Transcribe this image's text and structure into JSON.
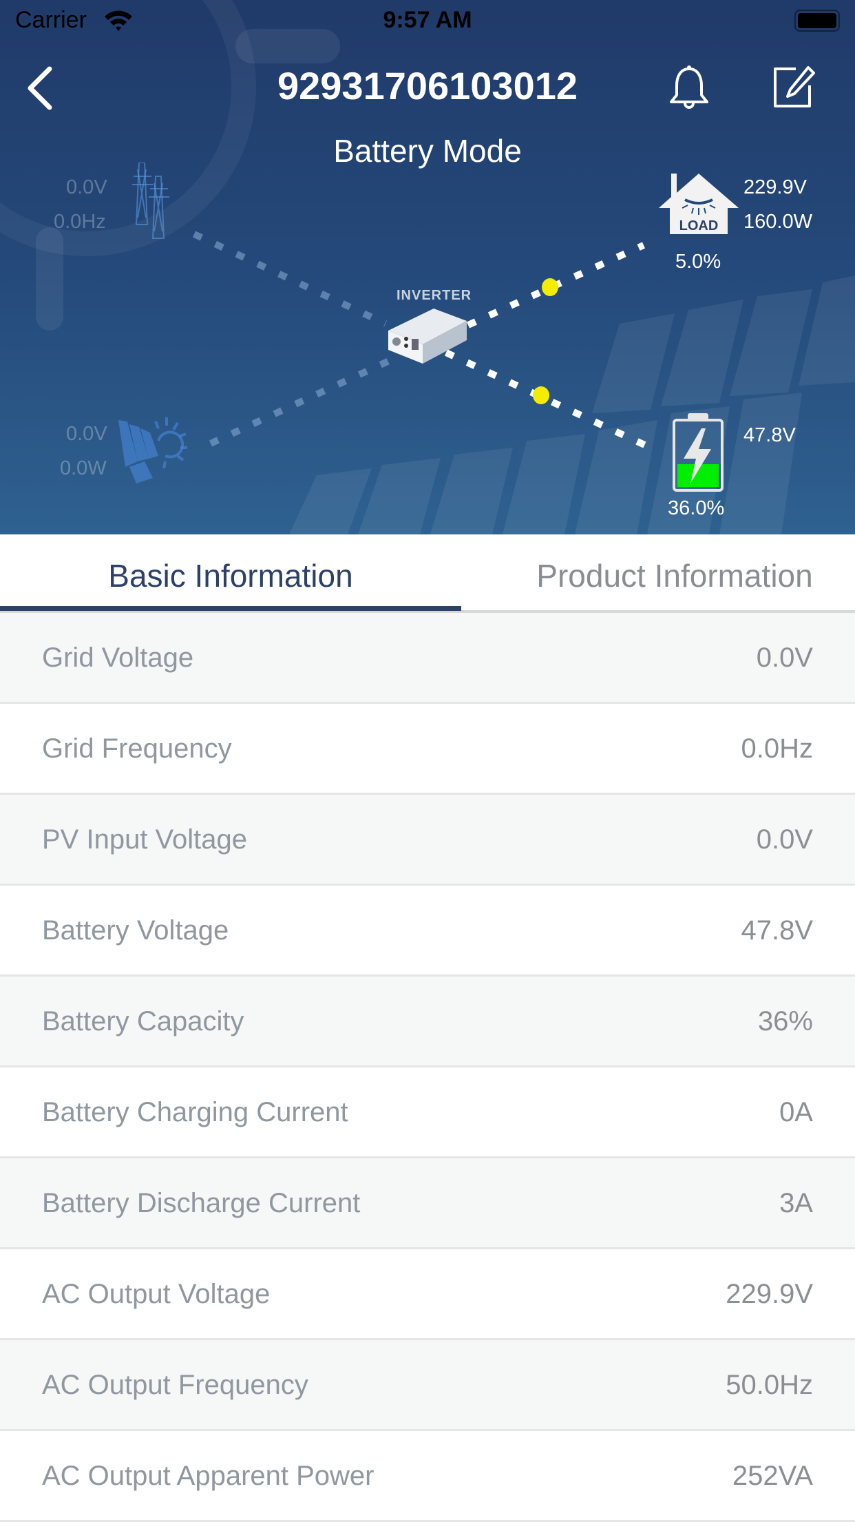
{
  "status_bar": {
    "carrier": "Carrier",
    "time": "9:57 AM"
  },
  "nav": {
    "title": "92931706103012",
    "back_icon": "chevron-left-icon",
    "bell_icon": "bell-icon",
    "edit_icon": "edit-icon"
  },
  "mode": "Battery Mode",
  "diagram": {
    "grid": {
      "voltage": "0.0V",
      "frequency": "0.0Hz"
    },
    "pv": {
      "voltage": "0.0V",
      "power": "0.0W"
    },
    "inverter_label": "INVERTER",
    "load": {
      "icon_label": "LOAD",
      "voltage": "229.9V",
      "power": "160.0W",
      "percent": "5.0%"
    },
    "battery": {
      "voltage": "47.8V",
      "percent": "36.0%",
      "level": 0.36
    },
    "colors": {
      "flow_dot": "#f5ec00",
      "battery_fill": "#00ee00"
    }
  },
  "tabs": [
    {
      "label": "Basic Information",
      "active": true
    },
    {
      "label": "Product Information",
      "active": false
    }
  ],
  "rows": [
    {
      "label": "Grid Voltage",
      "value": "0.0V"
    },
    {
      "label": "Grid Frequency",
      "value": "0.0Hz"
    },
    {
      "label": "PV Input Voltage",
      "value": "0.0V"
    },
    {
      "label": "Battery Voltage",
      "value": "47.8V"
    },
    {
      "label": "Battery Capacity",
      "value": "36%"
    },
    {
      "label": "Battery Charging Current",
      "value": "0A"
    },
    {
      "label": "Battery Discharge Current",
      "value": "3A"
    },
    {
      "label": "AC Output Voltage",
      "value": "229.9V"
    },
    {
      "label": "AC Output Frequency",
      "value": "50.0Hz"
    },
    {
      "label": "AC Output Apparent Power",
      "value": "252VA"
    }
  ]
}
